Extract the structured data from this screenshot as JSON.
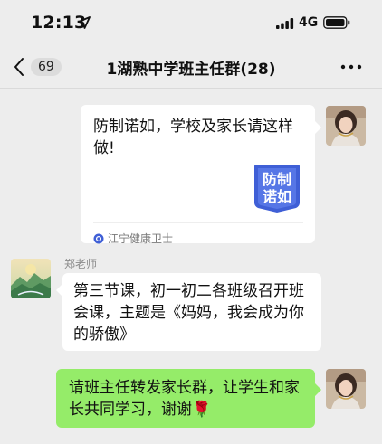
{
  "status_bar": {
    "time": "12:13",
    "network": "4G"
  },
  "header": {
    "back_count": "69",
    "title": "1湖熟中学班主任群(28)",
    "more_icon": "more-dots-icon"
  },
  "messages": [
    {
      "type": "link-card",
      "side": "right",
      "text": "防制诺如，学校及家长请这样做!",
      "thumb_text_line1": "防制",
      "thumb_text_line2": "诺如",
      "source": "江宁健康卫士"
    },
    {
      "type": "text",
      "side": "left",
      "sender": "郑老师",
      "text": "第三节课，初一初二各班级召开班会课，主题是《妈妈，我会成为你的骄傲》"
    },
    {
      "type": "text",
      "side": "right",
      "text": "请班主任转发家长群，让学生和家长共同学习，谢谢",
      "emoji": "🌹"
    }
  ],
  "colors": {
    "background": "#ededed",
    "bubble_self": "#95ec69",
    "bubble_other": "#ffffff",
    "thumb_blue": "#3f5fd6"
  }
}
